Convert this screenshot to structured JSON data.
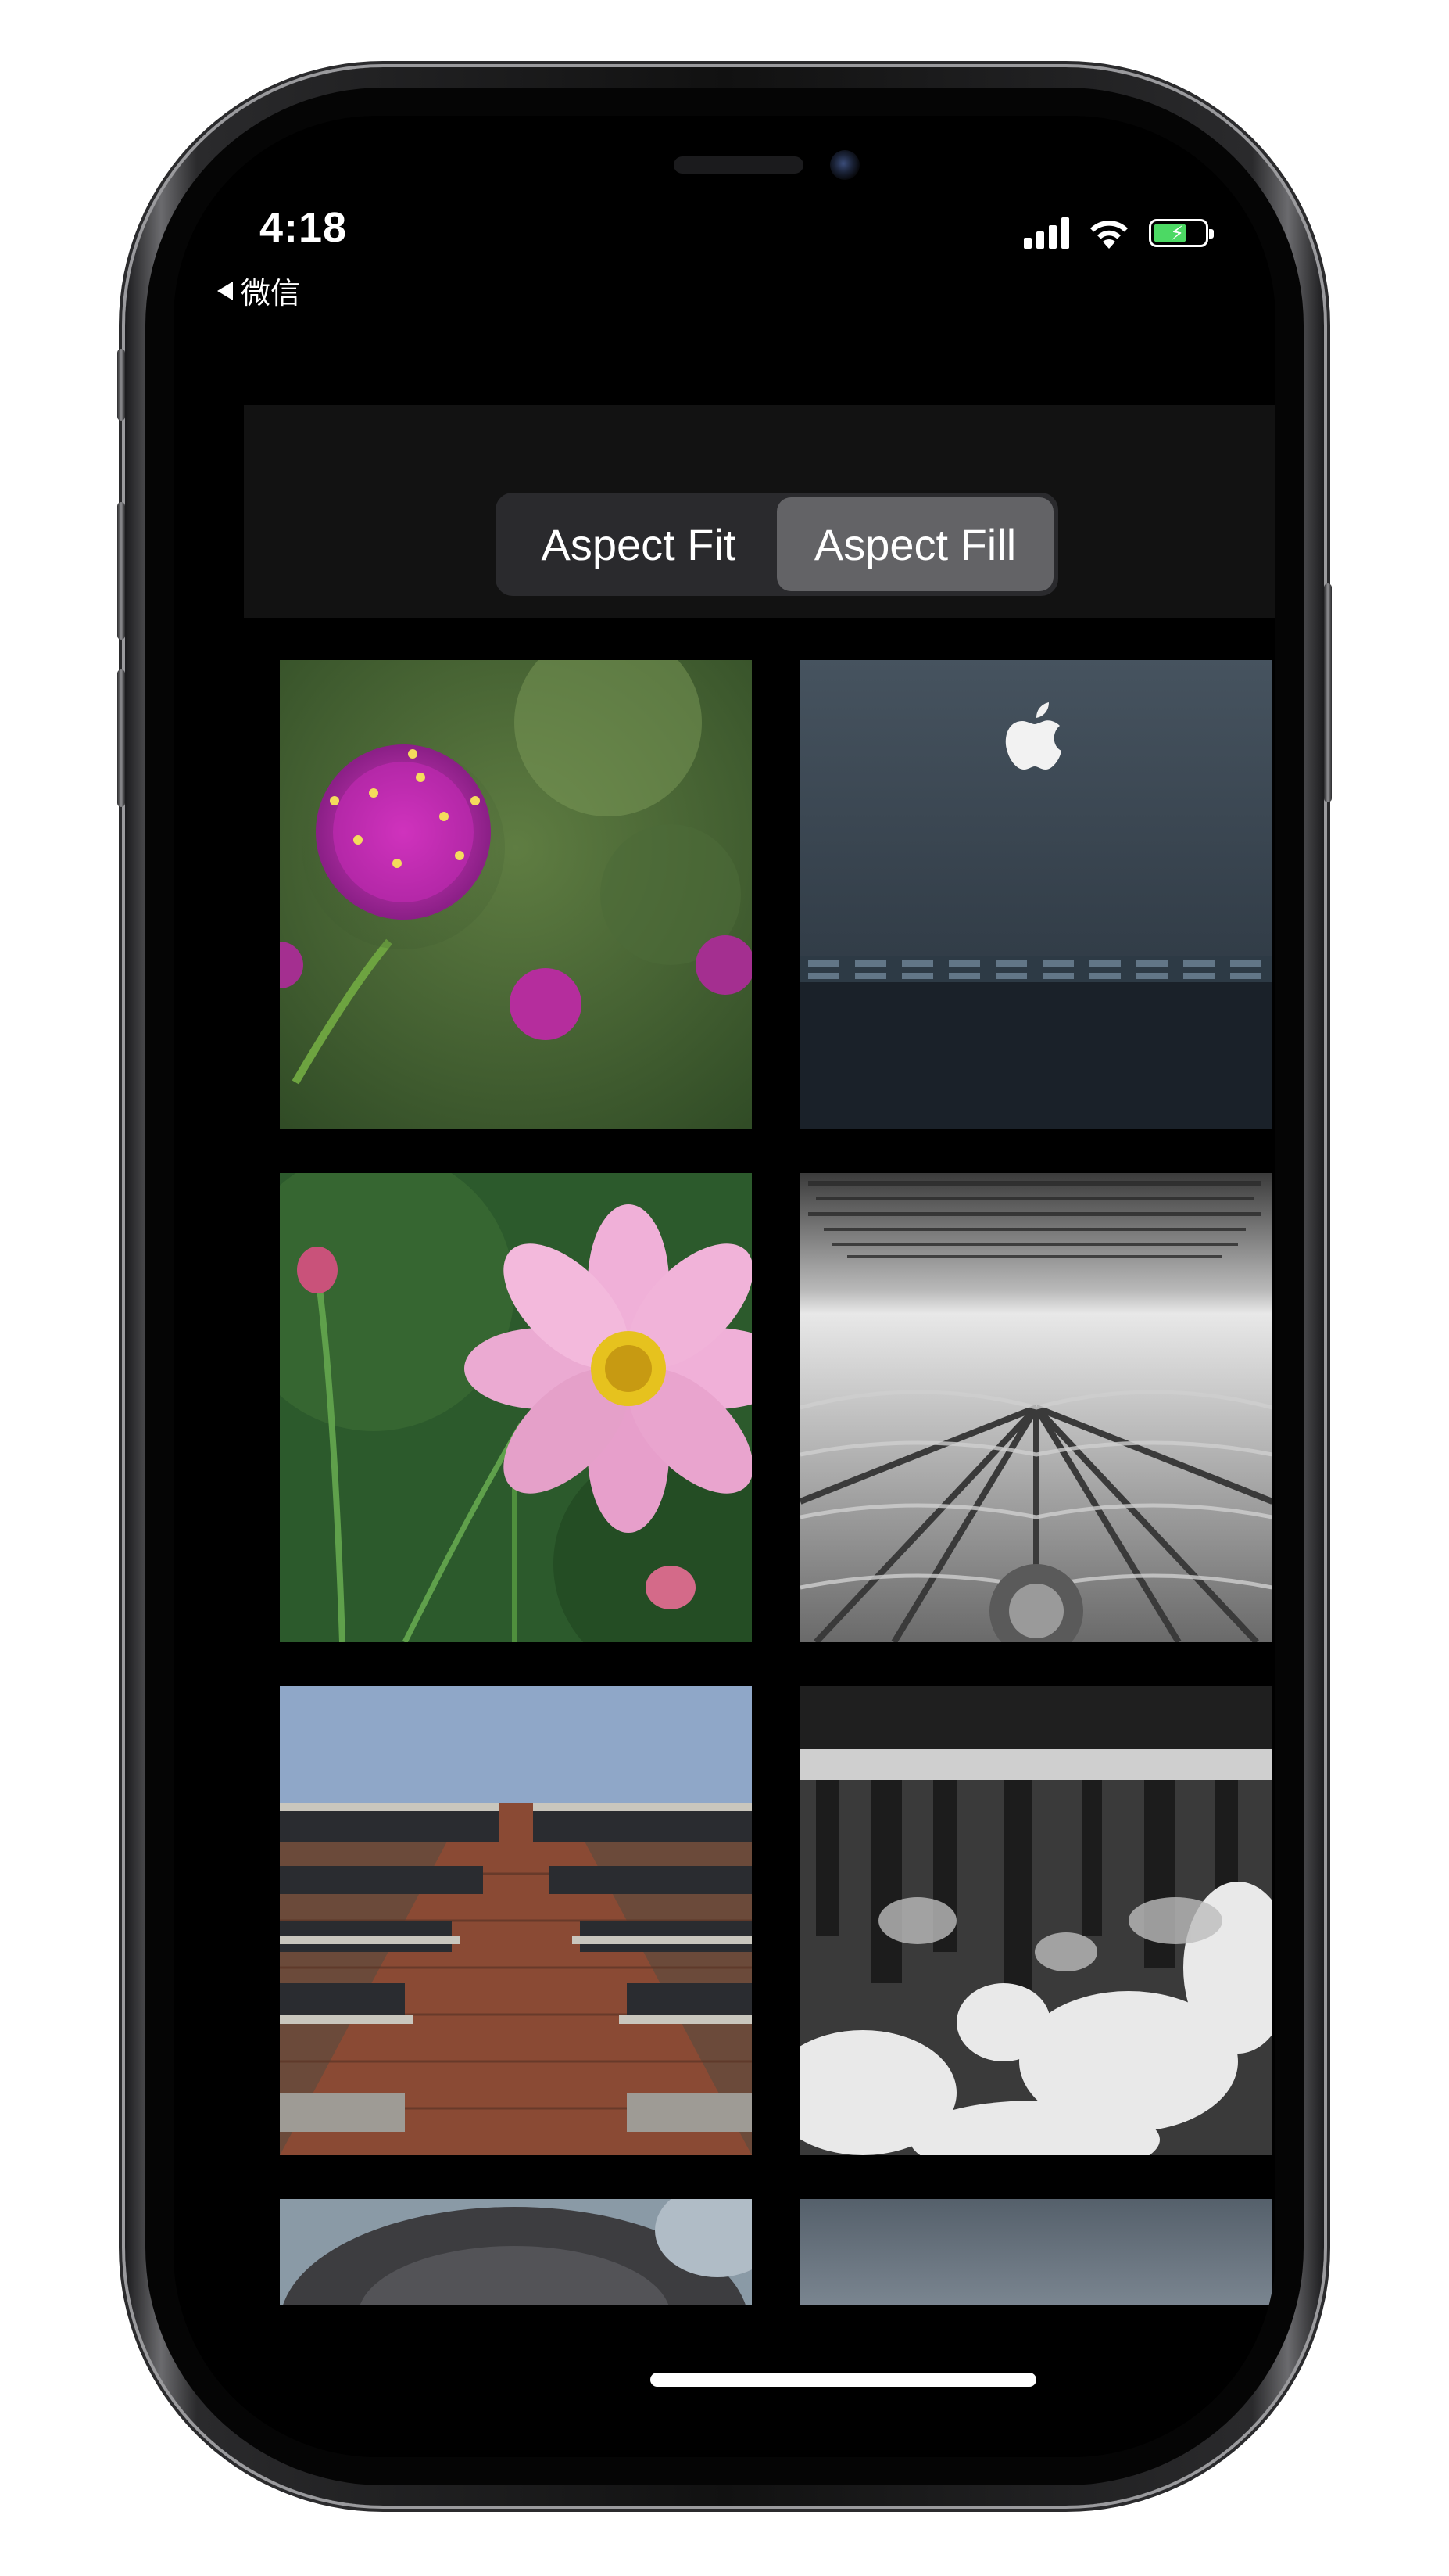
{
  "status_bar": {
    "time": "4:18",
    "back_app": "微信",
    "battery_color": "#4cd964"
  },
  "segmented_control": {
    "options": [
      "Aspect Fit",
      "Aspect Fill"
    ],
    "selected": "Aspect Fill"
  },
  "photos": [
    {
      "subject": "purple globe amaranth flower"
    },
    {
      "subject": "Apple store dark wall with logo"
    },
    {
      "subject": "pink cosmos flower"
    },
    {
      "subject": "ornate gothic stone ceiling with inscriptions"
    },
    {
      "subject": "brick building facade against blue sky"
    },
    {
      "subject": "frozen waterfall black and white"
    },
    {
      "subject": "dog fur close-up (partially visible)"
    },
    {
      "subject": "grey sky (partially visible)"
    }
  ],
  "icons": [
    "back-arrow-icon",
    "cellular-signal-icon",
    "wifi-icon",
    "battery-charging-icon",
    "apple-logo-icon"
  ]
}
